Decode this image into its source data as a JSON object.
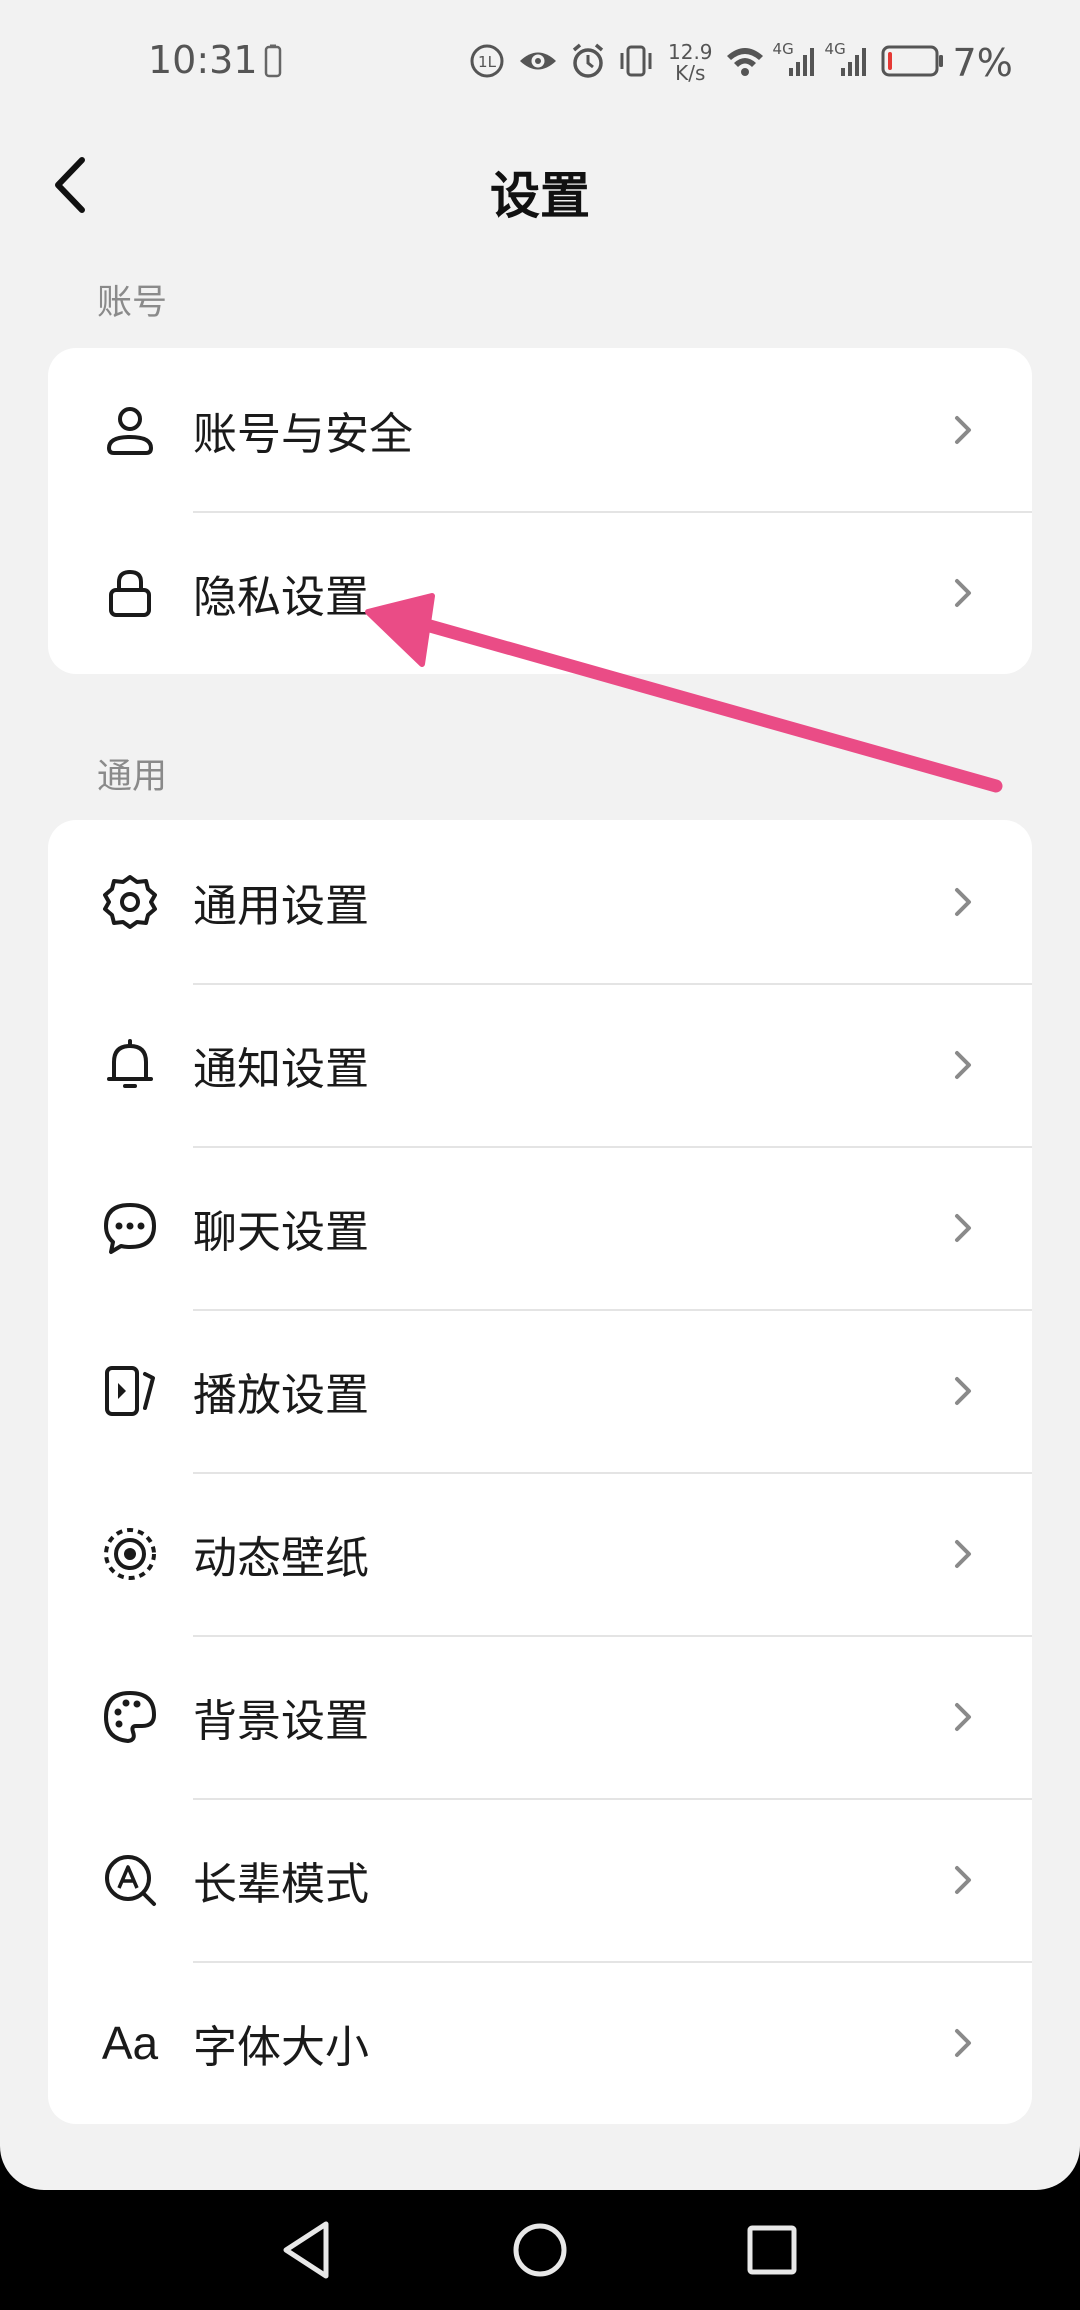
{
  "status_bar": {
    "time": "10:31",
    "speed_top": "12.9",
    "speed_bottom": "K/s",
    "net1": "4G",
    "net2": "4G",
    "battery_pct": "7%",
    "battery_level": 0.07,
    "battery_color": "#e53935",
    "icons": [
      "phone-icon",
      "data-saver-icon",
      "eye-icon",
      "alarm-icon",
      "vibrate-icon",
      "wifi-icon",
      "signal-icon",
      "battery-icon"
    ]
  },
  "header": {
    "title": "设置",
    "back_icon": "back-icon"
  },
  "sections": [
    {
      "label": "账号",
      "items": [
        {
          "label": "账号与安全",
          "icon": "user-icon"
        },
        {
          "label": "隐私设置",
          "icon": "lock-icon"
        }
      ]
    },
    {
      "label": "通用",
      "items": [
        {
          "label": "通用设置",
          "icon": "gear-icon"
        },
        {
          "label": "通知设置",
          "icon": "bell-icon"
        },
        {
          "label": "聊天设置",
          "icon": "chat-icon"
        },
        {
          "label": "播放设置",
          "icon": "play-icon"
        },
        {
          "label": "动态壁纸",
          "icon": "wallpaper-icon"
        },
        {
          "label": "背景设置",
          "icon": "palette-icon"
        },
        {
          "label": "长辈模式",
          "icon": "elder-mode-icon"
        },
        {
          "label": "字体大小",
          "icon": "font-size-icon",
          "icon_text": "Aa"
        }
      ]
    }
  ],
  "annotation": {
    "color": "#ea4c86",
    "target": "隐私设置"
  },
  "nav_bar": {
    "icons": [
      "nav-back-icon",
      "nav-home-icon",
      "nav-recents-icon"
    ]
  }
}
